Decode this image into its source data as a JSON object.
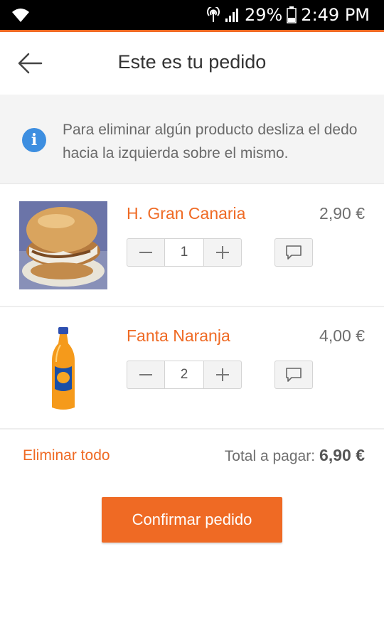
{
  "status_bar": {
    "battery_percent": "29%",
    "time": "2:49 PM",
    "icons": [
      "wifi-icon",
      "hotspot-icon",
      "signal-icon",
      "battery-icon"
    ]
  },
  "header": {
    "title": "Este es tu pedido",
    "back_icon": "arrow-left-icon"
  },
  "info": {
    "icon": "info-icon",
    "icon_glyph": "i",
    "text": "Para eliminar algún producto desliza el dedo hacia la izquierda sobre el mismo."
  },
  "items": [
    {
      "name": "H. Gran Canaria",
      "price": "2,90 €",
      "quantity": "1",
      "image": "sandwich-image"
    },
    {
      "name": "Fanta Naranja",
      "price": "4,00 €",
      "quantity": "2",
      "image": "orange-soda-bottle-image"
    }
  ],
  "footer": {
    "delete_all": "Eliminar todo",
    "total_label": "Total a pagar:",
    "total_value": "6,90 €",
    "confirm": "Confirmar pedido"
  },
  "colors": {
    "accent": "#ef6a24",
    "info_blue": "#3d8ee0",
    "status_bar": "#000000",
    "banner_bg": "#f4f4f4"
  }
}
